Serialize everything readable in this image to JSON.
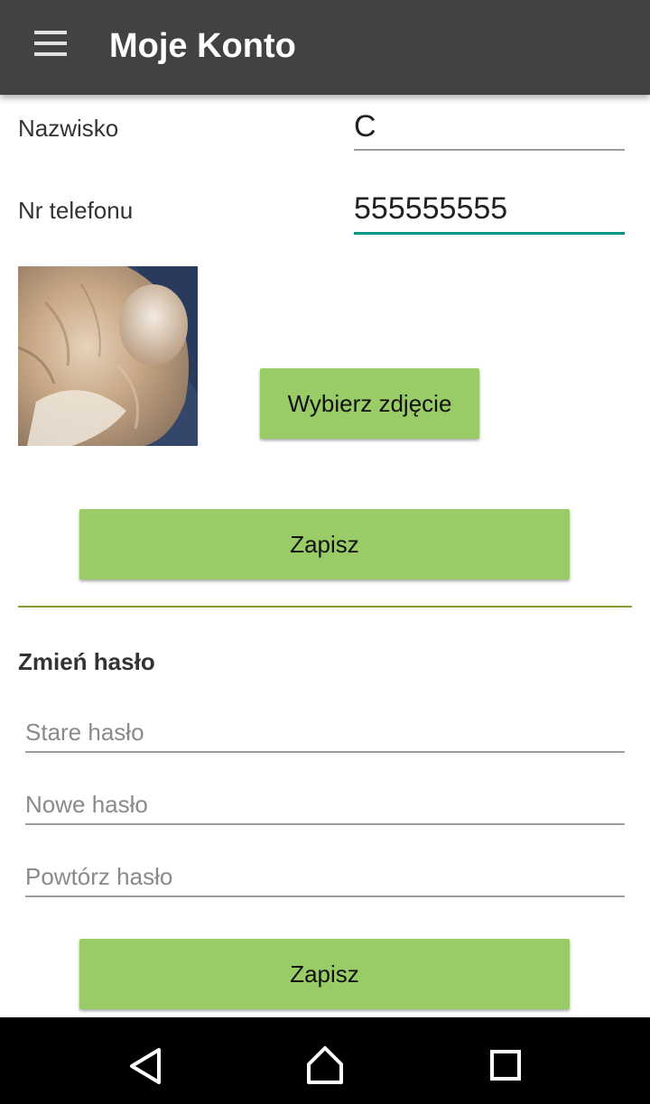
{
  "appbar": {
    "title": "Moje Konto",
    "menu_icon": "hamburger-menu-icon"
  },
  "profile": {
    "surname_label": "Nazwisko",
    "surname_value": "C",
    "phone_label": "Nr telefonu",
    "phone_value": "555555555",
    "choose_photo_label": "Wybierz zdjęcie",
    "save_label": "Zapisz"
  },
  "password": {
    "section_title": "Zmień hasło",
    "old_placeholder": "Stare hasło",
    "new_placeholder": "Nowe hasło",
    "repeat_placeholder": "Powtórz hasło",
    "save_label": "Zapisz"
  },
  "colors": {
    "appbar": "#424242",
    "button": "#99cc66",
    "active_underline": "#009688",
    "divider": "#8a9a2a"
  },
  "navbar": {
    "icons": [
      "back-icon",
      "home-icon",
      "recents-icon"
    ]
  }
}
